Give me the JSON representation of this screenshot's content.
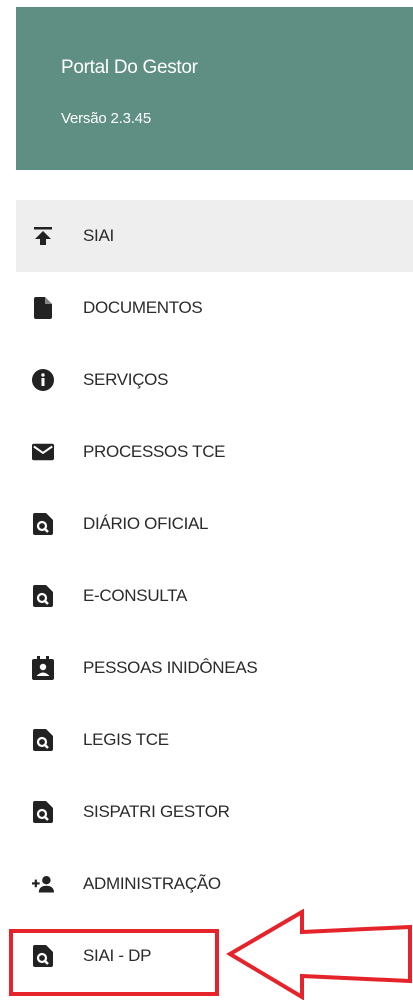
{
  "header": {
    "title": "Portal Do Gestor",
    "version": "Versão 2.3.45",
    "color": "#5e8f82"
  },
  "menu": {
    "items": [
      {
        "label": "SIAI",
        "icon": "upload-icon",
        "active": true
      },
      {
        "label": "DOCUMENTOS",
        "icon": "document-icon"
      },
      {
        "label": "SERVIÇOS",
        "icon": "info-icon"
      },
      {
        "label": "PROCESSOS TCE",
        "icon": "mail-icon"
      },
      {
        "label": "DIÁRIO OFICIAL",
        "icon": "search-document-icon"
      },
      {
        "label": "E-CONSULTA",
        "icon": "search-document-icon"
      },
      {
        "label": "PESSOAS INIDÔNEAS",
        "icon": "contact-badge-icon"
      },
      {
        "label": "LEGIS TCE",
        "icon": "search-document-icon"
      },
      {
        "label": "SISPATRI GESTOR",
        "icon": "search-document-icon"
      },
      {
        "label": "ADMINISTRAÇÃO",
        "icon": "add-person-icon"
      },
      {
        "label": "SIAI - DP",
        "icon": "search-document-icon",
        "highlighted": true
      }
    ]
  },
  "annotation": {
    "color": "#e4242a",
    "shapes": [
      "highlight-box",
      "left-arrow-icon"
    ]
  }
}
